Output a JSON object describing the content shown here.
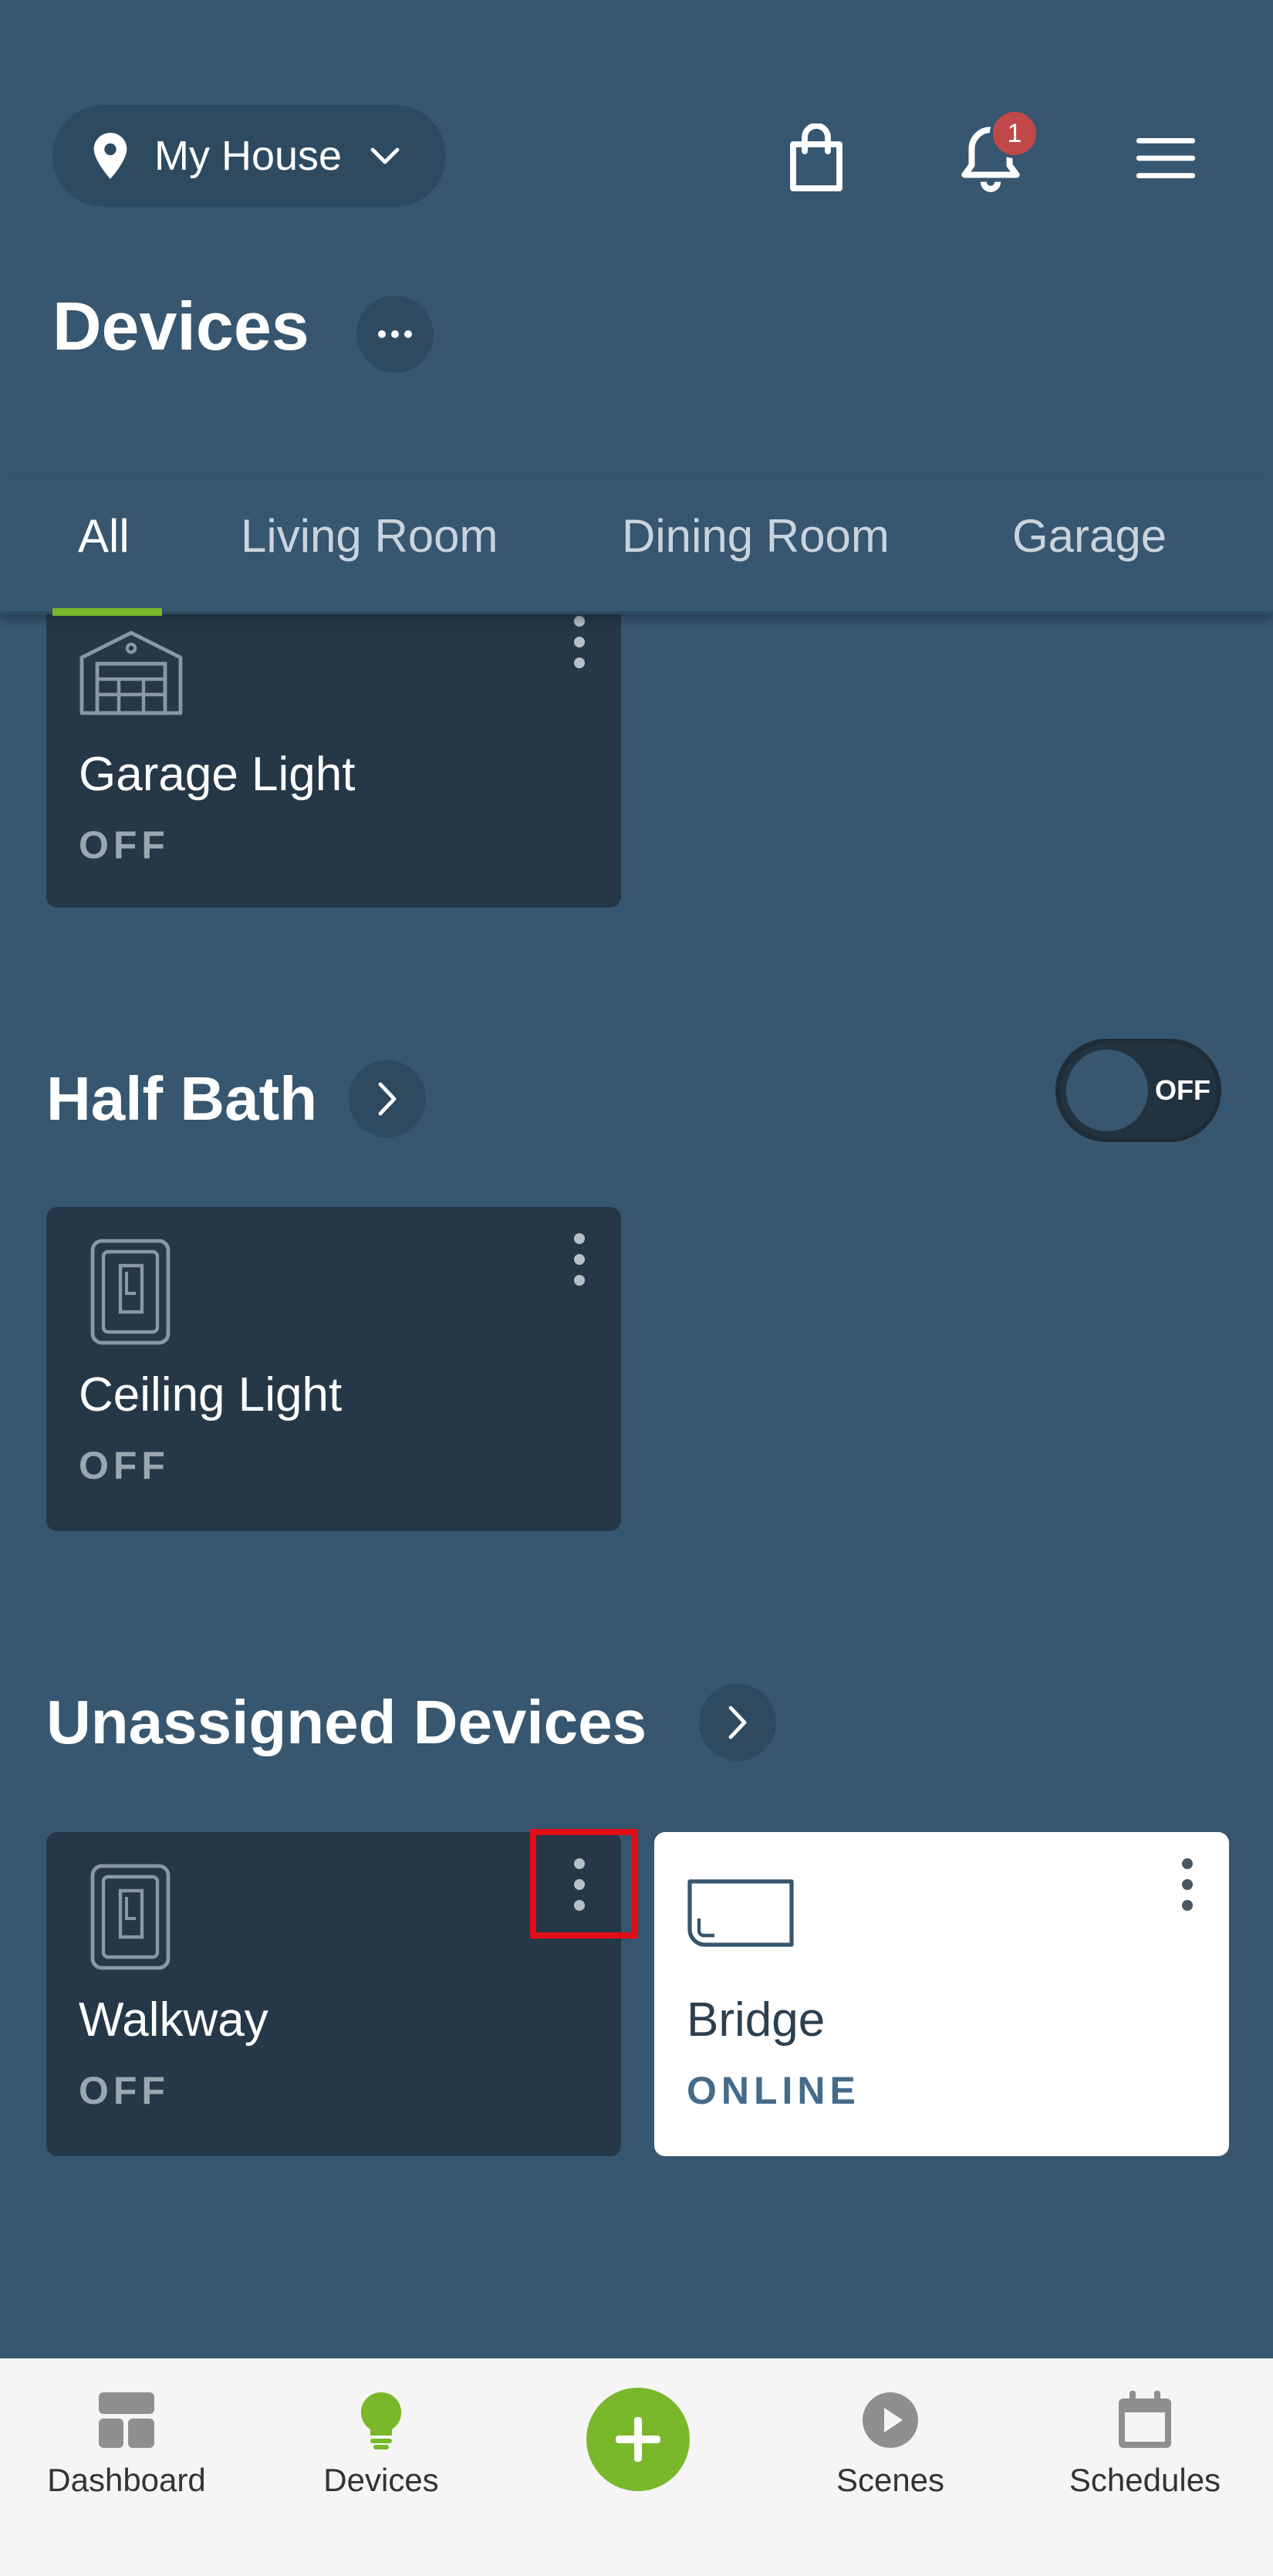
{
  "header": {
    "house_label": "My House",
    "notification_count": "1"
  },
  "page": {
    "title": "Devices"
  },
  "tabs": [
    {
      "label": "All",
      "active": true
    },
    {
      "label": "Living Room",
      "active": false
    },
    {
      "label": "Dining Room",
      "active": false
    },
    {
      "label": "Garage",
      "active": false
    }
  ],
  "sections": {
    "garage": {
      "cards": [
        {
          "name": "Garage Light",
          "state": "OFF",
          "icon": "garage-icon"
        }
      ]
    },
    "half_bath": {
      "title": "Half Bath",
      "toggle_label": "OFF",
      "cards": [
        {
          "name": "Ceiling Light",
          "state": "OFF",
          "icon": "light-switch-icon"
        }
      ]
    },
    "unassigned": {
      "title": "Unassigned Devices",
      "cards": [
        {
          "name": "Walkway",
          "state": "OFF",
          "icon": "light-switch-icon"
        },
        {
          "name": "Bridge",
          "state": "ONLINE",
          "icon": "bridge-icon"
        }
      ]
    }
  },
  "bottom_nav": [
    {
      "label": "Dashboard",
      "icon": "dashboard-icon"
    },
    {
      "label": "Devices",
      "icon": "lightbulb-icon",
      "active": true
    },
    {
      "label": "",
      "icon": "add-icon"
    },
    {
      "label": "Scenes",
      "icon": "play-icon"
    },
    {
      "label": "Schedules",
      "icon": "calendar-icon"
    }
  ],
  "colors": {
    "background": "#37566f",
    "card_dark": "#263847",
    "accent_green": "#79b82b",
    "badge_red": "#c14848",
    "highlight_red": "#e10f15"
  }
}
